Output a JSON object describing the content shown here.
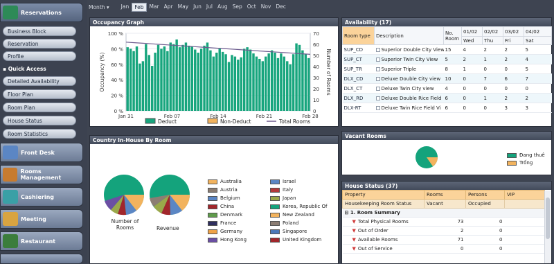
{
  "sidebar": {
    "reservations": "Reservations",
    "sub_items": [
      "Business Block",
      "Reservation",
      "Profile"
    ],
    "quick_access": "Quick Access",
    "quick_items": [
      "Detailed Availability",
      "Floor Plan",
      "Room Plan",
      "House Status",
      "Room Statistics"
    ],
    "modules": [
      "Front Desk",
      "Rooms Management",
      "Cashiering",
      "Meeting",
      "Restaurant"
    ]
  },
  "monthbar": {
    "label": "Month",
    "months": [
      "Jan",
      "Feb",
      "Mar",
      "Apr",
      "May",
      "Jun",
      "Jul",
      "Aug",
      "Sep",
      "Oct",
      "Nov",
      "Dec"
    ],
    "selected": "Feb"
  },
  "occupancy": {
    "title": "Occupancy Graph",
    "legend": [
      "Deduct",
      "Non-Deduct",
      "Total Rooms"
    ]
  },
  "country": {
    "title": "Country In-House By Room",
    "pie_labels": [
      "Number of Rooms",
      "Revenue"
    ],
    "legend_col1": [
      "Australia",
      "Austria",
      "Belgium",
      "China",
      "Denmark",
      "France",
      "Germany",
      "Hong Kong"
    ],
    "legend_col2": [
      "Israel",
      "Italy",
      "Japan",
      "Korea, Republic Of",
      "New Zealand",
      "Poland",
      "Singapore",
      "United Kingdom"
    ],
    "colors_col1": [
      "#f2b35e",
      "#8b7d73",
      "#5b86c4",
      "#a1262b",
      "#5f9b4b",
      "#2f2f5f",
      "#f0a347",
      "#6b4fa3"
    ],
    "colors_col2": [
      "#5b86c4",
      "#b23a3a",
      "#9aa84a",
      "#14a37c",
      "#f2b35e",
      "#8b7d73",
      "#4a78b8",
      "#a1262b"
    ]
  },
  "availability": {
    "title": "Availability (17)",
    "headers": [
      "Room type",
      "Description",
      "No. Room",
      "01/02",
      "02/02",
      "03/02",
      "04/02"
    ],
    "days": [
      "Wed",
      "Thu",
      "Fri",
      "Sat"
    ],
    "rows": [
      {
        "code": "SUP_CD",
        "desc": "Superior Double City View",
        "no": "15",
        "d1": "4",
        "d2": "2",
        "d3": "2",
        "d4": "5"
      },
      {
        "code": "SUP_CT",
        "desc": "Superior Twin City View",
        "no": "5",
        "d1": "2",
        "d2": "1",
        "d3": "2",
        "d4": "4"
      },
      {
        "code": "SUP_TR",
        "desc": "Superior Triple",
        "no": "8",
        "d1": "1",
        "d2": "0",
        "d3": "0",
        "d4": "5"
      },
      {
        "code": "DLX_CD",
        "desc": "Deluxe Double City view",
        "no": "10",
        "d1": "0",
        "d2": "7",
        "d3": "6",
        "d4": "7"
      },
      {
        "code": "DLX_CT",
        "desc": "Deluxe Twin City view",
        "no": "4",
        "d1": "0",
        "d2": "0",
        "d3": "0",
        "d4": "0"
      },
      {
        "code": "DLX_RD",
        "desc": "Deluxe Double Rice Field",
        "no": "6",
        "d1": "0",
        "d2": "1",
        "d3": "2",
        "d4": "2"
      },
      {
        "code": "DLX-RT",
        "desc": "Deluxe Twin Rice Field Vi",
        "no": "6",
        "d1": "0",
        "d2": "0",
        "d3": "3",
        "d4": "3"
      }
    ]
  },
  "vacant": {
    "title": "Vacant Rooms",
    "legend": [
      "Đang thuê",
      "Trống"
    ]
  },
  "house_status": {
    "title": "House Status (37)",
    "headers": [
      "Property",
      "Rooms",
      "Persons",
      "VIP"
    ],
    "sub_headers": [
      "Housekeeping Room Status",
      "Vacant",
      "Occupied"
    ],
    "group": "1. Room Summary",
    "rows": [
      {
        "label": "Total Physical Rooms",
        "rooms": "73",
        "persons": "0"
      },
      {
        "label": "Out of Order",
        "rooms": "2",
        "persons": "0"
      },
      {
        "label": "Available Rooms",
        "rooms": "71",
        "persons": "0"
      },
      {
        "label": "Out of Service",
        "rooms": "0",
        "persons": "0"
      }
    ]
  },
  "chart_data": {
    "type": "bar",
    "title": "Occupancy Graph",
    "xlabel": "",
    "ylabel": "Occupancy (%)",
    "y2label": "Number of Rooms",
    "ylim": [
      0,
      100
    ],
    "y2lim": [
      0,
      70
    ],
    "y_ticks": [
      "0 %",
      "20 %",
      "40 %",
      "60 %",
      "80 %",
      "100 %"
    ],
    "y2_ticks": [
      "0",
      "10",
      "20",
      "30",
      "40",
      "50",
      "60",
      "70"
    ],
    "x_ticks": [
      "Jan 31",
      "Feb 07",
      "Feb 14",
      "Feb 21",
      "Feb 28"
    ],
    "series": [
      {
        "name": "Deduct",
        "values": [
          82,
          80,
          77,
          83,
          61,
          64,
          86,
          72,
          58,
          75,
          85,
          80,
          83,
          77,
          88,
          86,
          92,
          82,
          85,
          88,
          84,
          83,
          79,
          75,
          80,
          84,
          88,
          78,
          70,
          75,
          81,
          76,
          73,
          63,
          72,
          70,
          66,
          69,
          80,
          82,
          79,
          74,
          70,
          67,
          64,
          70,
          74,
          78,
          75,
          68,
          74,
          70,
          64,
          60,
          73,
          87,
          85,
          78,
          73,
          68
        ]
      },
      {
        "name": "Non-Deduct",
        "values": [
          0,
          0,
          0,
          0,
          0,
          0,
          0,
          0,
          0,
          0,
          0,
          0,
          0,
          0,
          0,
          0,
          0,
          0,
          0,
          0,
          0,
          0,
          0,
          0,
          0,
          0,
          0,
          0,
          0,
          0,
          0,
          0,
          0,
          0,
          0,
          0,
          0,
          0,
          0,
          0,
          0,
          0,
          0,
          0,
          0,
          0,
          0,
          0,
          0,
          0,
          0,
          0,
          0,
          0,
          0,
          0,
          0,
          0,
          0,
          0
        ]
      },
      {
        "name": "Total Rooms",
        "line": [
          62,
          61.5,
          61,
          60.5,
          60,
          59.5,
          59,
          58.5,
          58,
          57.5,
          57,
          56.5,
          56,
          55.5,
          55,
          54.5,
          54,
          53.5,
          53,
          52.5,
          52,
          51.5,
          51
        ]
      }
    ]
  }
}
